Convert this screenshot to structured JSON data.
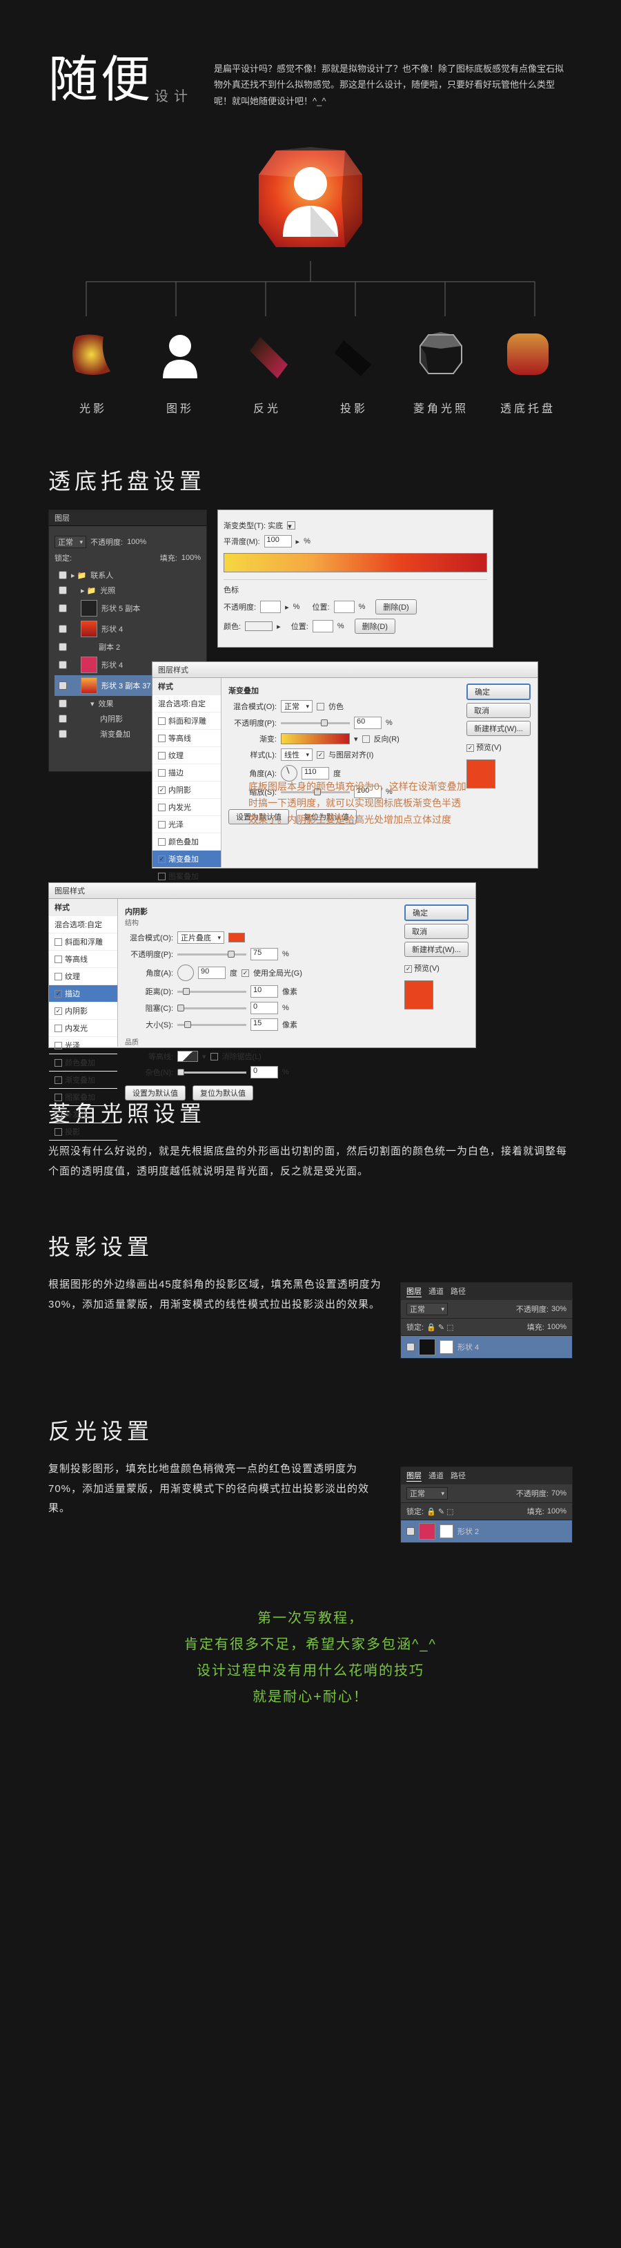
{
  "header": {
    "title_main": "随便",
    "title_sub": "设计",
    "intro": "是扁平设计吗？感觉不像！那就是拟物设计了？也不像！除了图标底板感觉有点像宝石拟物外真还找不到什么拟物感觉。那这是什么设计，随便啦，只要好看好玩管他什么类型呢！就叫她随便设计吧！^_^"
  },
  "row_labels": [
    "光影",
    "图形",
    "反光",
    "投影",
    "菱角光照",
    "透底托盘"
  ],
  "sections": {
    "s1": {
      "title": "透底托盘设置",
      "note": "底板图层本身的颜色填充设为0，这样在设渐变叠加时搞一下透明度，就可以实现图标底板渐变色半透效果了。内阴影主要是给高光处增加点立体过度"
    },
    "s2": {
      "title": "菱角光照设置",
      "desc": "光照没有什么好说的，就是先根据底盘的外形画出切割的面，然后切割面的颜色统一为白色，接着就调整每个面的透明度值，透明度越低就说明是背光面，反之就是受光面。"
    },
    "s3": {
      "title": "投影设置",
      "desc": "根据图形的外边缘画出45度斜角的投影区域，填充黑色设置透明度为30%，添加适量蒙版，用渐变模式的线性模式拉出投影淡出的效果。"
    },
    "s4": {
      "title": "反光设置",
      "desc": "复制投影图形，填充比地盘颜色稍微亮一点的红色设置透明度为70%，添加适量蒙版，用渐变模式下的径向模式拉出投影淡出的效果。"
    }
  },
  "layers_panel": {
    "tab": "图层",
    "mode_label": "正常",
    "opacity_label": "不透明度:",
    "opacity_val": "100%",
    "lock_label": "锁定:",
    "fill_label": "填充:",
    "fill_val": "100%",
    "folder": "联系人",
    "items": [
      "光照",
      "形状 5 副本",
      "形状 4",
      "副本 2",
      "形状 4",
      "形状 3 副本 37"
    ],
    "fx_label": "效果",
    "fx_items": [
      "内阴影",
      "渐变叠加"
    ]
  },
  "gradient_panel": {
    "title": "渐变类型(T): 实底",
    "smooth_label": "平滑度(M):",
    "smooth_val": "100",
    "pct": "%",
    "stops_title": "色标",
    "op_label": "不透明度:",
    "pos_label": "位置:",
    "del_btn": "删除(D)",
    "color_label": "颜色:"
  },
  "style_panel": {
    "title": "图层样式",
    "sidebar_title": "样式",
    "blend_opt": "混合选项:自定",
    "items": [
      "斜面和浮雕",
      "等高线",
      "纹理",
      "描边",
      "内阴影",
      "内发光",
      "光泽",
      "颜色叠加",
      "渐变叠加",
      "图案叠加",
      "外发光",
      "投影"
    ],
    "group_title": "渐变叠加",
    "group_title2": "内阴影",
    "struct": "结构",
    "blend_label": "混合模式(O):",
    "blend_val": "正常",
    "blend_val2": "正片叠底",
    "dither": "仿色",
    "opacity_label": "不透明度(P):",
    "opacity_val": "60",
    "opacity_val2": "75",
    "grad_label": "渐变:",
    "reverse": "反向(R)",
    "style_label": "样式(L):",
    "style_val": "线性",
    "align": "与图层对齐(I)",
    "angle_label": "角度(A):",
    "angle_val": "110",
    "angle_val2": "90",
    "deg": "度",
    "global": "使用全局光(G)",
    "dist_label": "距离(D):",
    "dist_val": "10",
    "px": "像素",
    "spread_label": "阻塞(C):",
    "spread_val": "0",
    "size_label": "大小(S):",
    "size_val": "15",
    "scale_label": "缩放(S):",
    "scale_val": "100",
    "quality": "品质",
    "contour_label": "等高线:",
    "anti": "消除锯齿(L)",
    "noise_label": "杂色(N):",
    "noise_val": "0",
    "btn_ok": "确定",
    "btn_cancel": "取消",
    "btn_new": "新建样式(W)...",
    "chk_preview": "预览(V)",
    "btn_default": "设置为默认值",
    "btn_reset": "复位为默认值"
  },
  "mini": {
    "tabs": [
      "图层",
      "通道",
      "路径"
    ],
    "mode": "正常",
    "opacity_label": "不透明度:",
    "op1": "30%",
    "op2": "70%",
    "lock": "锁定:",
    "fill": "填充:",
    "fill_val": "100%",
    "layer1": "形状 4",
    "layer2": "形状 2"
  },
  "footer": {
    "l1": "第一次写教程，",
    "l2": "肯定有很多不足，希望大家多包涵^_^",
    "l3": "设计过程中没有用什么花哨的技巧",
    "l4": "就是耐心+耐心！"
  }
}
